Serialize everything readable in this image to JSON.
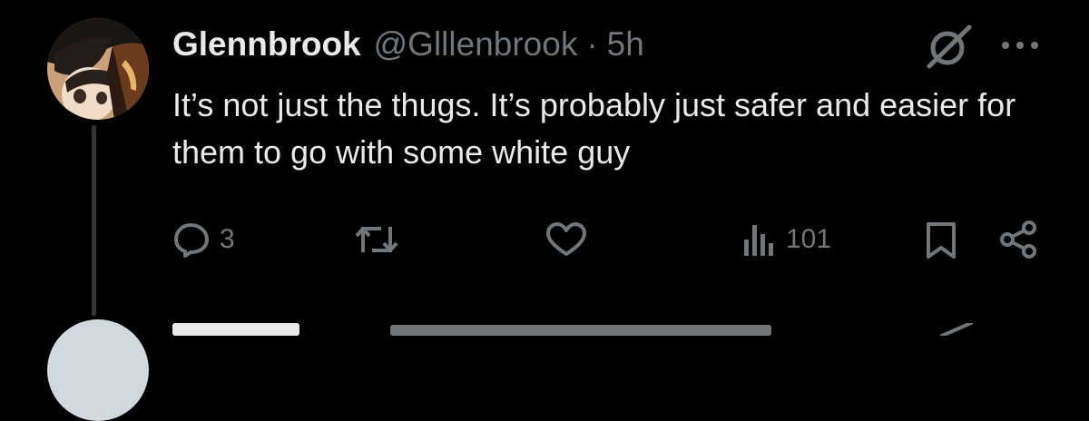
{
  "tweet": {
    "author_name": "Glennbrook",
    "handle": "@Glllenbrook",
    "separator": "·",
    "time": "5h",
    "text": "It’s not just the thugs. It’s probably just safer and easier for them to go with some white guy",
    "replies": "3",
    "reposts": "",
    "likes": "",
    "views": "101"
  },
  "icons": {
    "avatar": "anime-avatar",
    "grok": "grok-icon",
    "more": "more-icon",
    "reply": "reply-icon",
    "repost": "repost-icon",
    "like": "like-icon",
    "views": "views-icon",
    "bookmark": "bookmark-icon",
    "share": "share-icon"
  },
  "colors": {
    "background": "#000000",
    "text": "#e7e9ea",
    "muted": "#71767b",
    "thread_line": "#333639"
  }
}
